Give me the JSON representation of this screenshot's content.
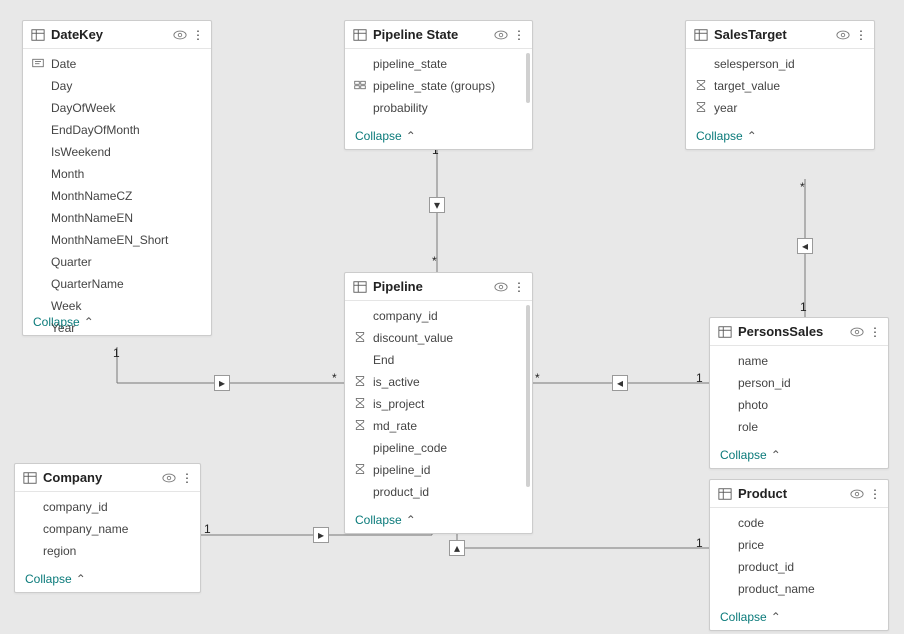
{
  "ui": {
    "collapse_label": "Collapse"
  },
  "tables": {
    "datekey": {
      "title": "DateKey",
      "fields": [
        {
          "name": "Date",
          "icon": "text"
        },
        {
          "name": "Day"
        },
        {
          "name": "DayOfWeek"
        },
        {
          "name": "EndDayOfMonth"
        },
        {
          "name": "IsWeekend"
        },
        {
          "name": "Month"
        },
        {
          "name": "MonthNameCZ"
        },
        {
          "name": "MonthNameEN"
        },
        {
          "name": "MonthNameEN_Short"
        },
        {
          "name": "Quarter"
        },
        {
          "name": "QuarterName"
        },
        {
          "name": "Week"
        },
        {
          "name": "Year"
        }
      ]
    },
    "pipelinestate": {
      "title": "Pipeline State",
      "fields": [
        {
          "name": "pipeline_state"
        },
        {
          "name": "pipeline_state (groups)",
          "icon": "group"
        },
        {
          "name": "probability"
        }
      ]
    },
    "salestarget": {
      "title": "SalesTarget",
      "fields": [
        {
          "name": "selesperson_id"
        },
        {
          "name": "target_value",
          "icon": "sigma"
        },
        {
          "name": "year",
          "icon": "sigma"
        }
      ]
    },
    "pipeline": {
      "title": "Pipeline",
      "fields": [
        {
          "name": "company_id"
        },
        {
          "name": "discount_value",
          "icon": "sigma"
        },
        {
          "name": "End"
        },
        {
          "name": "is_active",
          "icon": "sigma"
        },
        {
          "name": "is_project",
          "icon": "sigma"
        },
        {
          "name": "md_rate",
          "icon": "sigma"
        },
        {
          "name": "pipeline_code"
        },
        {
          "name": "pipeline_id",
          "icon": "sigma"
        },
        {
          "name": "product_id"
        }
      ]
    },
    "personssales": {
      "title": "PersonsSales",
      "fields": [
        {
          "name": "name"
        },
        {
          "name": "person_id"
        },
        {
          "name": "photo"
        },
        {
          "name": "role"
        }
      ]
    },
    "company": {
      "title": "Company",
      "fields": [
        {
          "name": "company_id"
        },
        {
          "name": "company_name"
        },
        {
          "name": "region"
        }
      ]
    },
    "product": {
      "title": "Product",
      "fields": [
        {
          "name": "code"
        },
        {
          "name": "price"
        },
        {
          "name": "product_id"
        },
        {
          "name": "product_name"
        }
      ]
    }
  },
  "relationships": [
    {
      "from": "pipelinestate",
      "to": "pipeline",
      "from_card": "1",
      "to_card": "*"
    },
    {
      "from": "datekey",
      "to": "pipeline",
      "from_card": "1",
      "to_card": "*"
    },
    {
      "from": "company",
      "to": "pipeline",
      "from_card": "1",
      "to_card": "*"
    },
    {
      "from": "product",
      "to": "pipeline",
      "from_card": "1",
      "to_card": "*"
    },
    {
      "from": "personssales",
      "to": "pipeline",
      "from_card": "1",
      "to_card": "*"
    },
    {
      "from": "personssales",
      "to": "salestarget",
      "from_card": "1",
      "to_card": "*"
    }
  ]
}
